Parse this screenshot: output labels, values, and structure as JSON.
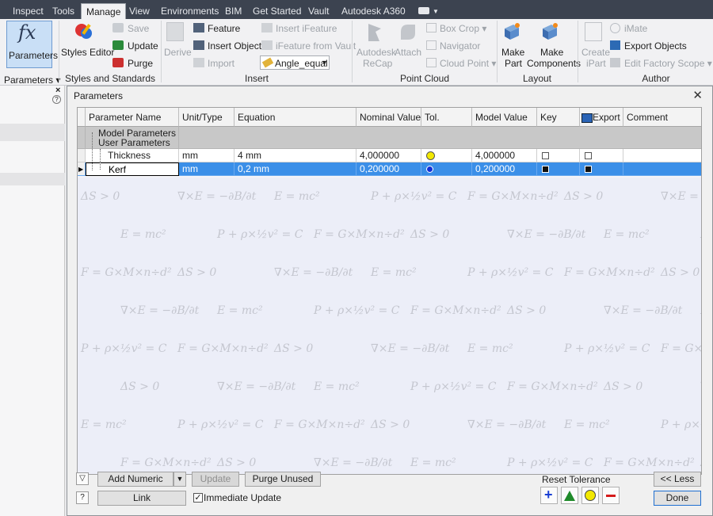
{
  "tabs": [
    "Inspect",
    "Tools",
    "Manage",
    "View",
    "Environments",
    "BIM",
    "Get Started",
    "Vault",
    "Autodesk A360"
  ],
  "active_tab": "Manage",
  "ribbon": {
    "parameters_label": "Parameters",
    "styles_editor": "Styles Editor",
    "save": "Save",
    "update": "Update",
    "purge": "Purge",
    "derive": "Derive",
    "feature": "Feature",
    "insert_object": "Insert Object",
    "import": "Import",
    "insert_ifeature": "Insert iFeature",
    "ifeature_from_vault": "iFeature from Vault",
    "angle_dropdown": "Angle_equal",
    "recap_line1": "Autodesk",
    "recap_line2": "ReCap",
    "attach": "Attach",
    "box_crop": "Box Crop",
    "navigator": "Navigator",
    "cloud_point": "Cloud Point",
    "make_part_1": "Make",
    "make_part_2": "Part",
    "make_comp_1": "Make",
    "make_comp_2": "Components",
    "create_ipart_1": "Create",
    "create_ipart_2": "iPart",
    "imate": "iMate",
    "export_objects": "Export Objects",
    "edit_factory_scope": "Edit Factory Scope"
  },
  "groups": {
    "parameters": "Parameters",
    "styles": "Styles and Standards",
    "insert": "Insert",
    "point_cloud": "Point Cloud",
    "layout": "Layout",
    "author": "Author"
  },
  "dialog": {
    "title": "Parameters",
    "columns": [
      "Parameter Name",
      "Unit/Type",
      "Equation",
      "Nominal Value",
      "Tol.",
      "Model Value",
      "Key",
      "Export",
      "Comment"
    ],
    "groups": [
      "Model Parameters",
      "User Parameters"
    ],
    "rows": [
      {
        "name": "Thickness",
        "unit": "mm",
        "equation": "4 mm",
        "nominal": "4,000000",
        "model": "4,000000",
        "tol_color": "#f2e800",
        "key": false,
        "export": false,
        "comment": ""
      },
      {
        "name": "Kerf",
        "unit": "mm",
        "equation": "0,2 mm",
        "nominal": "0,200000",
        "model": "0,200000",
        "tol_color": "#1030d8",
        "key": true,
        "export": true,
        "comment": ""
      }
    ],
    "buttons": {
      "add_numeric": "Add Numeric",
      "update": "Update",
      "purge_unused": "Purge Unused",
      "link": "Link",
      "immediate_update": "Immediate Update",
      "reset_tolerance": "Reset Tolerance",
      "less": "<< Less",
      "done": "Done"
    },
    "immediate_update_checked": true
  },
  "bg_formulas": [
    "ΔS > 0",
    "∇×E = −∂B/∂t",
    "E = mc²",
    "P + ρ×½v² = C",
    "F = G×M×n÷d²"
  ],
  "colors": {
    "accent": "#3b8fe8",
    "tabbar": "#3c4350"
  }
}
